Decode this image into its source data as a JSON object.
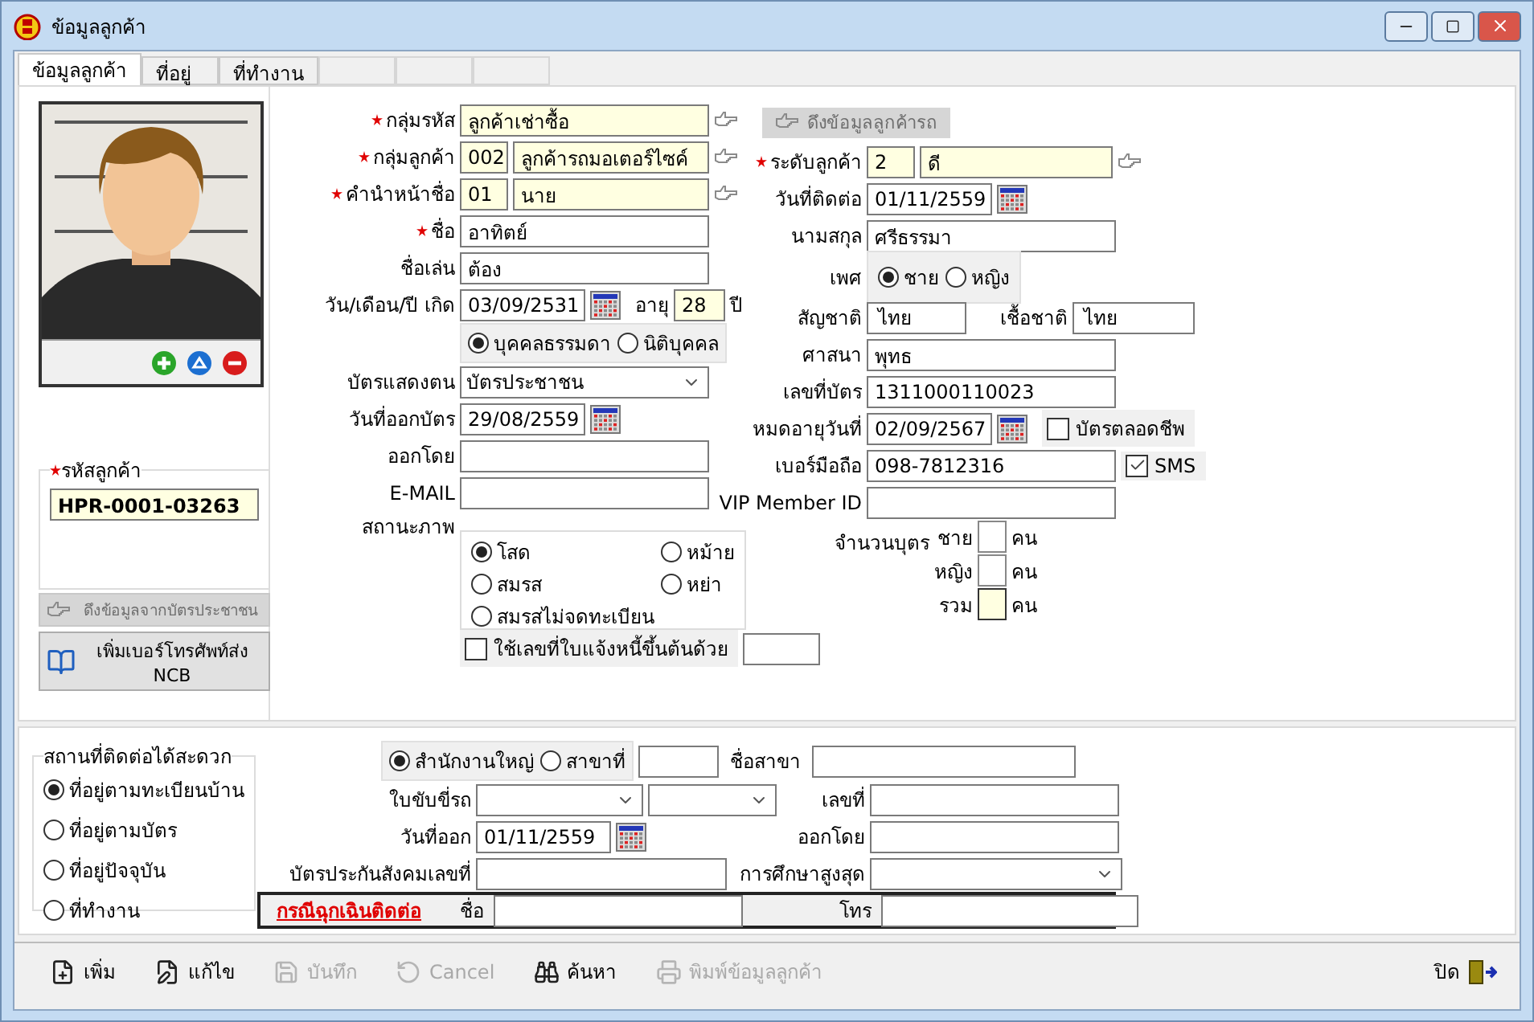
{
  "window": {
    "title": "ข้อมูลลูกค้า"
  },
  "tabs": [
    {
      "label": "ข้อมูลลูกค้า",
      "selected": true
    },
    {
      "label": "ที่อยู่",
      "selected": false
    },
    {
      "label": "ที่ทำงาน",
      "selected": false
    }
  ],
  "customer_code": {
    "label": "รหัสลูกค้า",
    "required": true,
    "value": "HPR-0001-03263"
  },
  "side_buttons": [
    {
      "label": "ดึงข้อมูลจากบัตรประชาชน",
      "disabled": true,
      "kind": "pointer"
    },
    {
      "label": "เพิ่มเบอร์โทรศัพท์ส่ง NCB",
      "disabled": false,
      "kind": "book"
    }
  ],
  "left_fields": [
    {
      "kind": "lookup",
      "label": "กลุ่มรหัส",
      "required": true,
      "values": [
        "ลูกค้าเช่าซื้อ"
      ]
    },
    {
      "kind": "lookup",
      "label": "กลุ่มลูกค้า",
      "required": true,
      "values": [
        "002",
        "ลูกค้ารถมอเตอร์ไซค์"
      ]
    },
    {
      "kind": "lookup",
      "label": "คำนำหน้าชื่อ",
      "required": true,
      "values": [
        "01",
        "นาย"
      ]
    },
    {
      "kind": "text",
      "label": "ชื่อ",
      "required": true,
      "value": "อาทิตย์"
    },
    {
      "kind": "text",
      "label": "ชื่อเล่น",
      "required": false,
      "value": "ต้อง"
    },
    {
      "kind": "birth",
      "label": "วัน/เดือน/ปี เกิด",
      "required": false,
      "value": "03/09/2531",
      "age_label": "อายุ",
      "age": "28",
      "unit": "ปี"
    },
    {
      "kind": "radios",
      "options": [
        {
          "label": "บุคคลธรรมดา",
          "selected": true
        },
        {
          "label": "นิติบุคคล",
          "selected": false
        }
      ]
    },
    {
      "kind": "select",
      "label": "บัตรแสดงตน",
      "required": false,
      "value": "บัตรประชาชน"
    },
    {
      "kind": "date",
      "label": "วันที่ออกบัตร",
      "required": false,
      "value": "29/08/2559"
    },
    {
      "kind": "text",
      "label": "ออกโดย",
      "required": false
    },
    {
      "kind": "text",
      "label": "E-MAIL",
      "required": false
    },
    {
      "kind": "status",
      "label": "สถานะภาพ",
      "options": [
        {
          "label": "โสด",
          "selected": true
        },
        {
          "label": "หม้าย",
          "selected": false
        },
        {
          "label": "สมรส",
          "selected": false
        },
        {
          "label": "หย่า",
          "selected": false
        },
        {
          "label": "สมรสไม่จดทะเบียน",
          "selected": false
        }
      ]
    },
    {
      "kind": "checkbox",
      "label": "ใช้เลขที่ใบแจ้งหนี้ขึ้นต้นด้วย",
      "checked": false
    }
  ],
  "right_fields": [
    {
      "kind": "button",
      "label": "ดึงข้อมูลลูกค้ารถ",
      "disabled": true
    },
    {
      "kind": "lookup",
      "label": "ระดับลูกค้า",
      "required": true,
      "values": [
        "2",
        "ดี"
      ]
    },
    {
      "kind": "date",
      "label": "วันที่ติดต่อ",
      "required": false,
      "value": "01/11/2559"
    },
    {
      "kind": "text",
      "label": "นามสกุล",
      "required": false,
      "value": "ศรีธรรมา"
    },
    {
      "kind": "radios",
      "label": "เพศ",
      "options": [
        {
          "label": "ชาย",
          "selected": true
        },
        {
          "label": "หญิง",
          "selected": false
        }
      ]
    },
    {
      "kind": "pair",
      "label": "สัญชาติ",
      "required": false,
      "value": "ไทย",
      "label2": "เชื้อชาติ",
      "value2": "ไทย"
    },
    {
      "kind": "text",
      "label": "ศาสนา",
      "required": false,
      "value": "พุทธ"
    },
    {
      "kind": "text",
      "label": "เลขที่บัตร",
      "required": false,
      "value": "1311000110023"
    },
    {
      "kind": "date",
      "label": "หมดอายุวันที่",
      "required": false,
      "value": "02/09/2567",
      "check": {
        "label": "บัตรตลอดชีพ",
        "checked": false
      }
    },
    {
      "kind": "text",
      "label": "เบอร์มือถือ",
      "required": false,
      "value": "098-7812316",
      "check": {
        "label": "SMS",
        "checked": true
      }
    },
    {
      "kind": "text",
      "label": "VIP Member ID",
      "required": false
    },
    {
      "kind": "children",
      "label": "จำนวนบุตร",
      "rows": [
        {
          "label": "ชาย",
          "unit": "คน",
          "readonly": false
        },
        {
          "label": "หญิง",
          "unit": "คน",
          "readonly": false
        },
        {
          "label": "รวม",
          "unit": "คน",
          "readonly": true
        }
      ]
    }
  ],
  "contact_place": {
    "title": "สถานที่ติดต่อได้สะดวก",
    "options": [
      {
        "label": "ที่อยู่ตามทะเบียนบ้าน",
        "selected": true
      },
      {
        "label": "ที่อยู่ตามบัตร",
        "selected": false
      },
      {
        "label": "ที่อยู่ปัจจุบัน",
        "selected": false
      },
      {
        "label": "ที่ทำงาน",
        "selected": false
      }
    ]
  },
  "office": {
    "options": [
      {
        "label": "สำนักงานใหญ่",
        "selected": true
      },
      {
        "label": "สาขาที่",
        "selected": false
      }
    ],
    "branch_name_label": "ชื่อสาขา"
  },
  "license": {
    "label": "ใบขับขี่รถ",
    "number_label": "เลขที่"
  },
  "license_issue": {
    "label": "วันที่ออก",
    "value": "01/11/2559",
    "issuer_label": "ออกโดย"
  },
  "social_security": {
    "label": "บัตรประกันสังคมเลขที่",
    "education_label": "การศึกษาสูงสุด"
  },
  "emergency": {
    "link": "กรณีฉุกเฉินติดต่อ",
    "name_label": "ชื่อ",
    "phone_label": "โทร"
  },
  "toolbar": [
    {
      "kind": "new",
      "label": "เพิ่ม",
      "disabled": false
    },
    {
      "kind": "edit",
      "label": "แก้ไข",
      "disabled": false
    },
    {
      "kind": "save",
      "label": "บันทึก",
      "disabled": true
    },
    {
      "kind": "cancel",
      "label": "Cancel",
      "disabled": true
    },
    {
      "kind": "search",
      "label": "ค้นหา",
      "disabled": false
    },
    {
      "kind": "print",
      "label": "พิมพ์ข้อมูลลูกค้า",
      "disabled": true
    }
  ],
  "close_button": {
    "label": "ปิด"
  }
}
